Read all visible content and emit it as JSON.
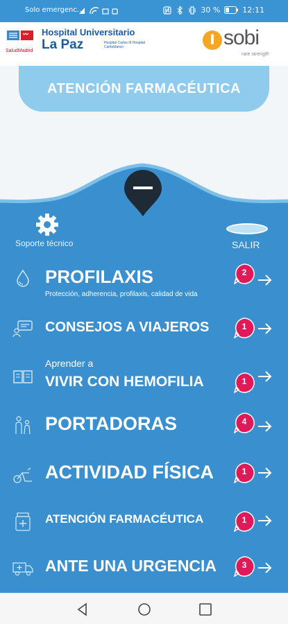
{
  "status_bar": {
    "carrier": "Solo emergenc...",
    "battery": "30 %",
    "time": "12:11"
  },
  "header": {
    "hospital_line1": "Hospital Universitario",
    "hospital_line2": "La Paz",
    "hospital_small": "Hospital Carlos III Hospital Cantoblanco",
    "region": "SaludMadrid",
    "sponsor": "sobi",
    "sponsor_tagline": "rare strength"
  },
  "banner": {
    "title": "ATENCIÓN FARMACÉUTICA"
  },
  "panel": {
    "support_label": "Soporte técnico",
    "exit_label": "SALIR"
  },
  "menu": [
    {
      "icon": "drop-icon",
      "title": "PROFILAXIS",
      "subtitle": "Protección, adherencia, profilaxis, calidad de vida",
      "badge": "2"
    },
    {
      "icon": "chat-icon",
      "title": "CONSEJOS A VIAJEROS",
      "badge": "1"
    },
    {
      "icon": "book-icon",
      "pretitle": "Aprender a",
      "title": "VIVIR CON HEMOFILIA",
      "badge": "1"
    },
    {
      "icon": "people-icon",
      "title": "PORTADORAS",
      "badge": "4"
    },
    {
      "icon": "bike-icon",
      "title": "ACTIVIDAD FÍSICA",
      "badge": "1"
    },
    {
      "icon": "medicine-icon",
      "title": "ATENCIÓN FARMACÉUTICA",
      "badge": "1"
    },
    {
      "icon": "ambulance-icon",
      "title": "ANTE UNA URGENCIA",
      "badge": "3"
    }
  ],
  "colors": {
    "status_bar": "#3a94d3",
    "panel": "#3a8fcf",
    "badge": "#e0195a",
    "banner": "#8fcbed"
  }
}
